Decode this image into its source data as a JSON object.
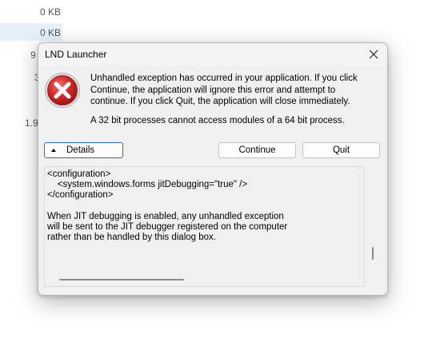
{
  "background": {
    "sizes": [
      "0 KB",
      "0 KB",
      "9",
      "3",
      "1.9"
    ]
  },
  "dialog": {
    "title": "LND Launcher",
    "close_icon": "close-icon",
    "error_icon": "error-icon",
    "message": "Unhandled exception has occurred in your application. If you click Continue, the application will ignore this error and attempt to continue. If you click Quit, the application will close immediately.",
    "error_detail": "A 32 bit processes cannot access modules of a 64 bit process.",
    "buttons": {
      "details": "Details",
      "continue": "Continue",
      "quit": "Quit"
    },
    "details_text": "<configuration>\n    <system.windows.forms jitDebugging=\"true\" />\n</configuration>\n\nWhen JIT debugging is enabled, any unhandled exception\nwill be sent to the JIT debugger registered on the computer\nrather than be handled by this dialog box."
  },
  "colors": {
    "accent": "#2b6cc4",
    "error_red": "#c8272c",
    "dialog_bg": "#f0f0f0"
  }
}
